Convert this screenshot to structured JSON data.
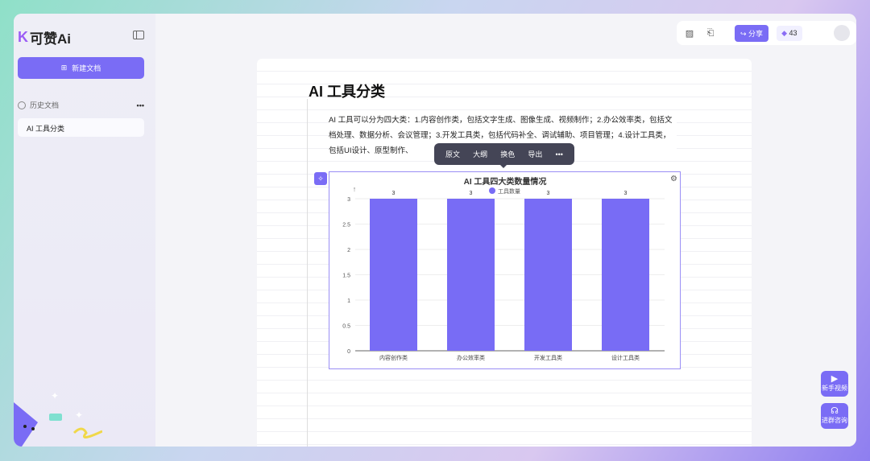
{
  "app": {
    "name": "可赞Ai",
    "logo_mark": "K"
  },
  "sidebar": {
    "new_doc": "新建文档",
    "history_label": "历史文档",
    "more": "•••",
    "items": [
      {
        "label": "AI 工具分类"
      }
    ]
  },
  "topbar": {
    "share": "分享",
    "credits": "43"
  },
  "doc": {
    "title": "AI 工具分类",
    "paragraph": "AI 工具可以分为四大类：1.内容创作类，包括文字生成、图像生成、视频制作；2.办公效率类，包括文档处理、数据分析、会议管理；3.开发工具类，包括代码补全、调试辅助、项目管理；4.设计工具类，包括UI设计、原型制作、"
  },
  "toolbar": {
    "items": [
      "原文",
      "大纲",
      "换色",
      "导出",
      "•••"
    ]
  },
  "floating": {
    "video": "新手视频",
    "group": "进群咨询"
  },
  "colors": {
    "accent": "#7a6cf5",
    "bar": "#786cf5"
  },
  "chart_data": {
    "type": "bar",
    "title": "AI 工具四大类数量情况",
    "categories": [
      "内容创作类",
      "办公效率类",
      "开发工具类",
      "设计工具类"
    ],
    "series": [
      {
        "name": "工具数量",
        "values": [
          3,
          3,
          3,
          3
        ]
      }
    ],
    "ylim": [
      0,
      3
    ],
    "yticks": [
      "0",
      "0.5",
      "1",
      "1.5",
      "2",
      "2.5",
      "3"
    ],
    "grid": true,
    "legend": "top"
  }
}
